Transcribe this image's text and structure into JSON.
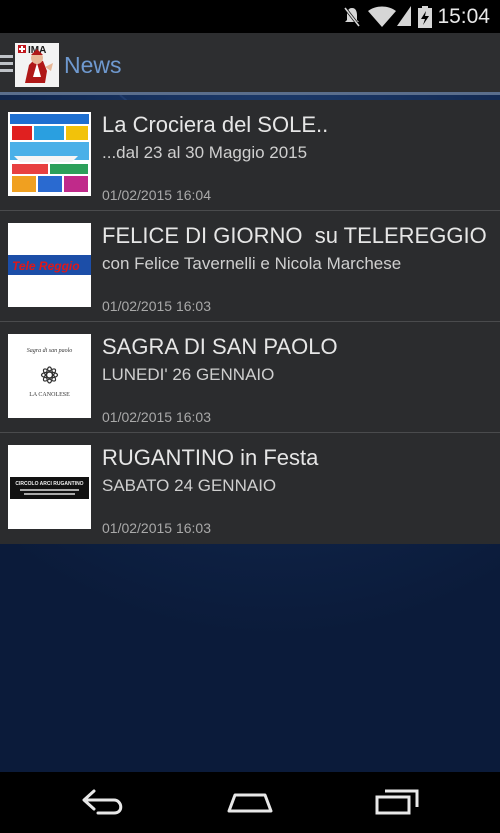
{
  "status_bar": {
    "time": "15:04",
    "icons": [
      "mute-icon",
      "wifi-icon",
      "battery-charging-icon"
    ]
  },
  "action_bar": {
    "title": "News",
    "logo_text": "IMA"
  },
  "news": [
    {
      "title": "La Crociera del SOLE..",
      "subtitle": "...dal 23 al 30 Maggio 2015",
      "date": "01/02/2015 16:04",
      "thumb": "cruise-flyer"
    },
    {
      "title": "FELICE DI GIORNO  su TELEREGGIO",
      "subtitle": "con Felice Tavernelli e Nicola Marchese",
      "date": "01/02/2015 16:03",
      "thumb_text": "Tele Reggio"
    },
    {
      "title": "SAGRA DI SAN PAOLO",
      "subtitle": "LUNEDI' 26 GENNAIO",
      "date": "01/02/2015 16:03",
      "thumb_text_top": "Sagra di san paolo",
      "thumb_text_bottom": "LA CANOLESE"
    },
    {
      "title": "RUGANTINO in Festa",
      "subtitle": "SABATO 24 GENNAIO",
      "date": "01/02/2015 16:03",
      "thumb_text": "CIRCOLO ARCI RUGANTINO"
    }
  ],
  "nav_bar": {
    "icons": [
      "back-icon",
      "home-icon",
      "recent-apps-icon"
    ]
  },
  "colors": {
    "accent": "#6f99cf",
    "list_bg": "#2b2c2e",
    "action_bar": "#2d2e30"
  }
}
